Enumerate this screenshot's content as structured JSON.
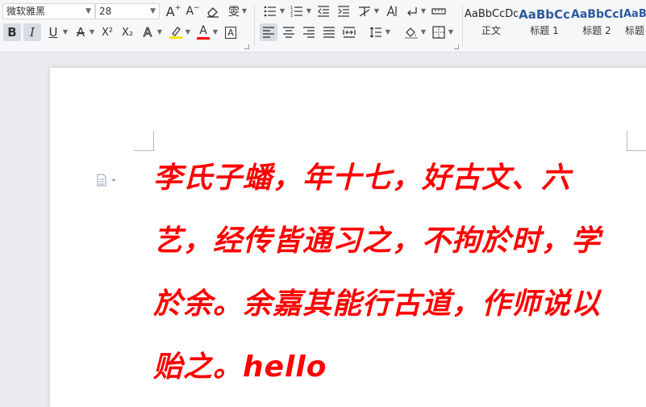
{
  "font": {
    "name": "微软雅黑",
    "size": "28"
  },
  "toolbar": {
    "grow_font": "A",
    "shrink_font": "A",
    "phonetic": "雯",
    "bold": "B",
    "italic": "I",
    "underline": "U",
    "strikethrough": "A",
    "superscript": "X²",
    "subscript": "X₂",
    "text_effect": "A",
    "font_color_letter": "A",
    "char_border": "A"
  },
  "colors": {
    "highlight": "#ffe000",
    "font_color": "#ff0000",
    "heading": "#2e5a9e",
    "text": "#ff0000"
  },
  "styles": [
    {
      "sample": "AaBbCcDd",
      "label": "正文"
    },
    {
      "sample": "AaBbCc",
      "label": "标题 1"
    },
    {
      "sample": "AaBbCcD",
      "label": "标题 2"
    },
    {
      "sample": "AaBl",
      "label": "标题"
    }
  ],
  "document": {
    "lines": [
      "李氏子蟠，年十七，好古文、六",
      "艺，经传皆通习之，不拘於时，学",
      "於余。余嘉其能行古道，作师说以",
      "贻之。hello"
    ]
  }
}
